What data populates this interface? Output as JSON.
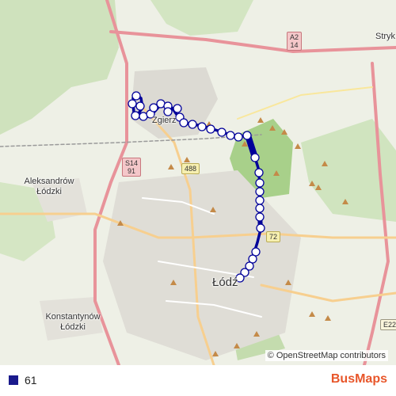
{
  "map": {
    "places": [
      {
        "id": "zgierz",
        "label": "Zgierz"
      },
      {
        "id": "aleksandrow",
        "label": "Aleksandrów Łódzki"
      },
      {
        "id": "konstantynow",
        "label": "Konstantynów Łódzki"
      },
      {
        "id": "lodz",
        "label": "Łódź"
      },
      {
        "id": "stryk",
        "label": "Stryk"
      }
    ],
    "road_shields": [
      {
        "id": "a2-e30",
        "lines": [
          "A2",
          "14"
        ]
      },
      {
        "id": "s14-e91",
        "lines": [
          "S14",
          "91"
        ]
      },
      {
        "id": "r488",
        "lines": [
          "488"
        ]
      },
      {
        "id": "r72",
        "lines": [
          "72"
        ]
      },
      {
        "id": "e22",
        "lines": [
          "E22"
        ]
      }
    ],
    "route_color": "#000099",
    "attribution": "© OpenStreetMap contributors"
  },
  "legend": {
    "route_label": "61",
    "route_color": "#1a1a8c"
  },
  "brand": {
    "part1": "Bus",
    "part2": "Maps",
    "color1": "#e8562a",
    "color2": "#e8562a"
  }
}
